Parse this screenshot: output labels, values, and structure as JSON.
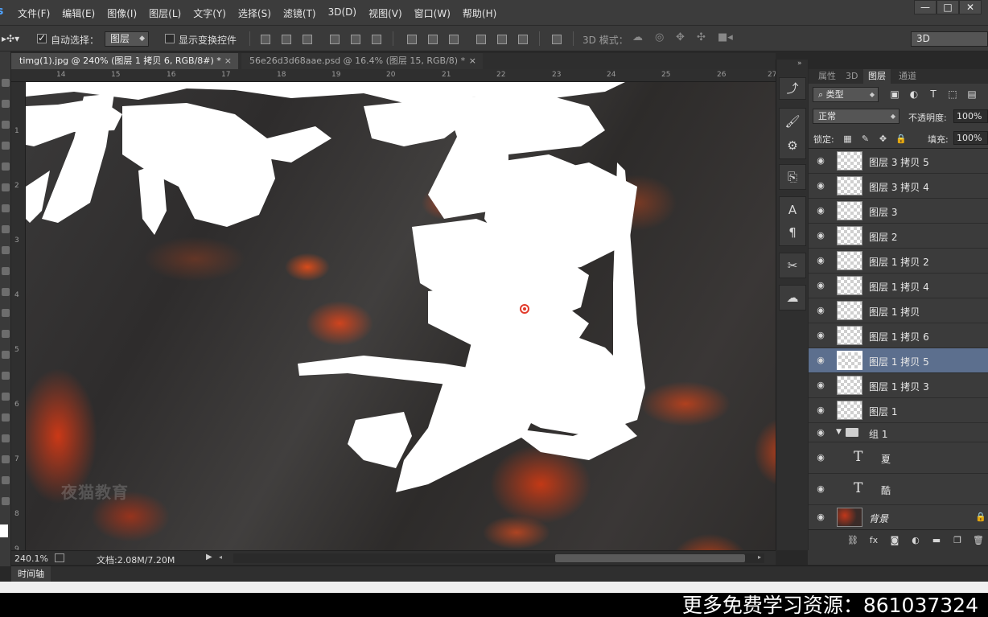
{
  "menu": [
    "文件(F)",
    "编辑(E)",
    "图像(I)",
    "图层(L)",
    "文字(Y)",
    "选择(S)",
    "滤镜(T)",
    "3D(D)",
    "视图(V)",
    "窗口(W)",
    "帮助(H)"
  ],
  "window_buttons": {
    "minimize": "—",
    "restore": "□",
    "close": "✕"
  },
  "options": {
    "auto_select_label": "自动选择：",
    "auto_select_value": "图层",
    "show_transform_label": "显示变换控件",
    "mode_3d_label": "3D 模式：",
    "workspace_value": "3D"
  },
  "tabs": [
    {
      "title": "timg(1).jpg @ 240% (图层 1 拷贝 6, RGB/8#) *",
      "close": "×"
    },
    {
      "title": "56e26d3d68aae.psd @ 16.4% (图层 15, RGB/8) *",
      "close": "×"
    }
  ],
  "ruler_h": [
    "14",
    "15",
    "16",
    "17",
    "18",
    "19",
    "20",
    "21",
    "22",
    "23",
    "24",
    "25",
    "26",
    "27"
  ],
  "ruler_v": [
    "1",
    "2",
    "3",
    "4",
    "5",
    "6",
    "7",
    "8",
    "9"
  ],
  "canvas": {
    "watermark": "夜猫教育"
  },
  "panel": {
    "tabs": [
      "属性",
      "3D",
      "图层",
      "通道"
    ],
    "active_tab": "图层",
    "filter_kind": "类型",
    "blend_mode": "正常",
    "opacity_label": "不透明度:",
    "opacity_value": "100%",
    "lock_label": "锁定:",
    "fill_label": "填充:",
    "fill_value": "100%"
  },
  "layers": [
    {
      "name": "图层 3 拷贝 5",
      "kind": "pixel",
      "selected": false
    },
    {
      "name": "图层 3 拷贝 4",
      "kind": "pixel",
      "selected": false
    },
    {
      "name": "图层 3",
      "kind": "pixel",
      "selected": false
    },
    {
      "name": "图层 2",
      "kind": "pixel",
      "selected": false
    },
    {
      "name": "图层 1 拷贝 2",
      "kind": "pixel",
      "selected": false
    },
    {
      "name": "图层 1 拷贝 4",
      "kind": "pixel",
      "selected": false
    },
    {
      "name": "图层 1 拷贝",
      "kind": "pixel",
      "selected": false
    },
    {
      "name": "图层 1 拷贝 6",
      "kind": "pixel",
      "selected": false
    },
    {
      "name": "图层 1 拷贝 5",
      "kind": "pixel",
      "selected": true
    },
    {
      "name": "图层 1 拷贝 3",
      "kind": "pixel",
      "selected": false
    },
    {
      "name": "图层 1",
      "kind": "pixel",
      "selected": false
    },
    {
      "name": "组 1",
      "kind": "group",
      "selected": false
    },
    {
      "name": "夏",
      "kind": "text",
      "selected": false
    },
    {
      "name": "酷",
      "kind": "text",
      "selected": false
    },
    {
      "name": "背景",
      "kind": "background",
      "selected": false
    }
  ],
  "status": {
    "zoom": "240.1%",
    "doc": "文档:2.08M/7.20M"
  },
  "timeline": {
    "label": "时间轴"
  },
  "promo": "更多免费学习资源：861037324"
}
